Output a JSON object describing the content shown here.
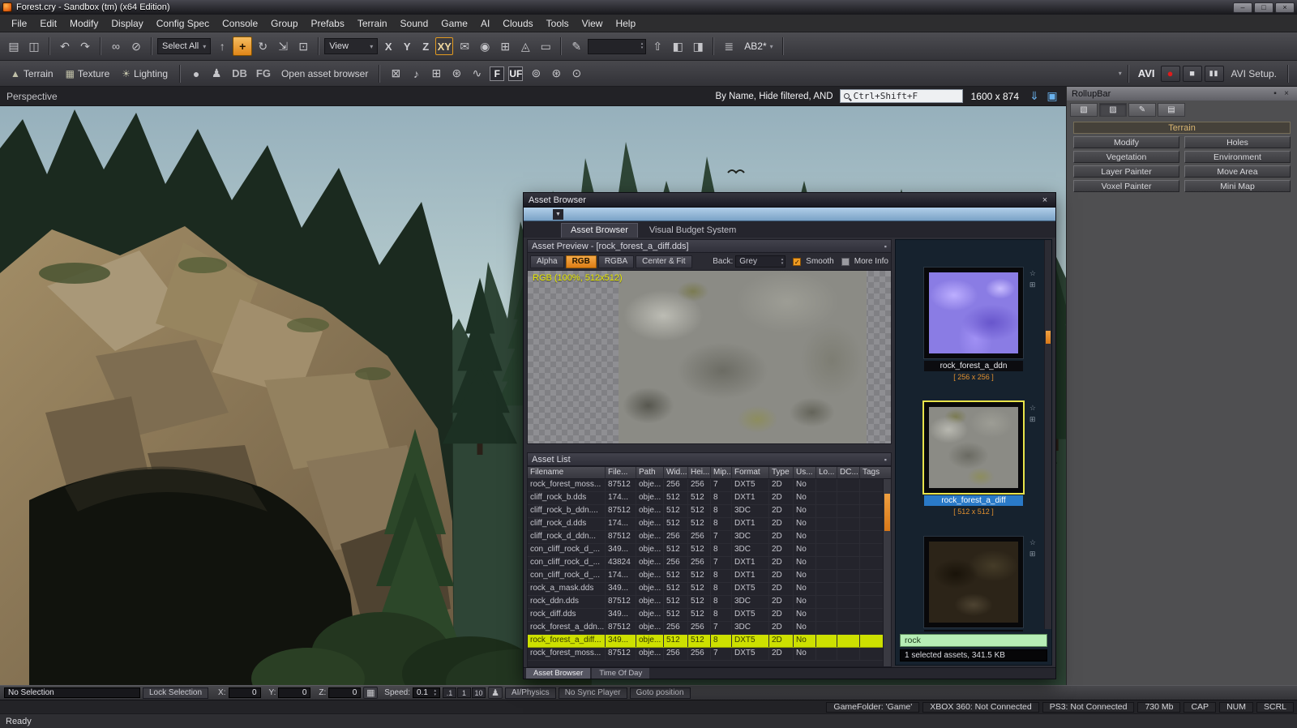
{
  "ui": {
    "dropdown_arrow": "▾",
    "spinner_up": "▴",
    "spinner_down": "▾",
    "pin_glyph": "▪",
    "star_glyph": "☆",
    "corner_glyph": "⊞"
  },
  "titlebar": {
    "title": "Forest.cry - Sandbox (tm) (x64 Edition)",
    "minimize": "–",
    "maximize": "□",
    "close": "×"
  },
  "menu": {
    "items": [
      {
        "label": "File",
        "name": "menu-file"
      },
      {
        "label": "Edit",
        "name": "menu-edit"
      },
      {
        "label": "Modify",
        "name": "menu-modify"
      },
      {
        "label": "Display",
        "name": "menu-display"
      },
      {
        "label": "Config Spec",
        "name": "menu-config-spec"
      },
      {
        "label": "Console",
        "name": "menu-console"
      },
      {
        "label": "Group",
        "name": "menu-group"
      },
      {
        "label": "Prefabs",
        "name": "menu-prefabs"
      },
      {
        "label": "Terrain",
        "name": "menu-terrain"
      },
      {
        "label": "Sound",
        "name": "menu-sound"
      },
      {
        "label": "Game",
        "name": "menu-game"
      },
      {
        "label": "AI",
        "name": "menu-ai"
      },
      {
        "label": "Clouds",
        "name": "menu-clouds"
      },
      {
        "label": "Tools",
        "name": "menu-tools"
      },
      {
        "label": "View",
        "name": "menu-view"
      },
      {
        "label": "Help",
        "name": "menu-help"
      }
    ]
  },
  "toolbar_main": {
    "file_icons": [
      {
        "glyph": "▤",
        "name": "open-file-icon"
      },
      {
        "glyph": "◫",
        "name": "save-icon"
      }
    ],
    "history_icons": [
      {
        "glyph": "↶",
        "name": "undo-icon"
      },
      {
        "glyph": "↷",
        "name": "redo-icon"
      }
    ],
    "link_icons": [
      {
        "glyph": "∞",
        "name": "link-icon"
      },
      {
        "glyph": "⊘",
        "name": "unlink-icon"
      }
    ],
    "select_all_value": "Select All",
    "transform_icons": [
      {
        "glyph": "↑",
        "name": "follow-terrain-icon"
      },
      {
        "glyph": "+",
        "name": "move-tool-icon",
        "active": true
      },
      {
        "glyph": "↻",
        "name": "rotate-tool-icon"
      },
      {
        "glyph": "⇲",
        "name": "scale-tool-icon"
      },
      {
        "glyph": "⊡",
        "name": "snap-icon"
      }
    ],
    "view_value": "View",
    "axis_buttons": [
      {
        "label": "X",
        "name": "axis-x-button"
      },
      {
        "label": "Y",
        "name": "axis-y-button"
      },
      {
        "label": "Z",
        "name": "axis-z-button"
      },
      {
        "label": "XY",
        "name": "axis-xy-button",
        "active": true
      }
    ],
    "misc_icons": [
      {
        "glyph": "✉",
        "name": "mail-icon"
      },
      {
        "glyph": "◉",
        "name": "camera-icon"
      },
      {
        "glyph": "⊞",
        "name": "grid-icon"
      },
      {
        "glyph": "◬",
        "name": "angle-snap-icon"
      },
      {
        "glyph": "▭",
        "name": "ruler-icon"
      }
    ],
    "script_icons": [
      {
        "glyph": "✎",
        "name": "script-icon"
      }
    ],
    "combo_value": "",
    "post_combo_icons": [
      {
        "glyph": "⇧",
        "name": "export-icon"
      },
      {
        "glyph": "◧",
        "name": "clone-icon"
      },
      {
        "glyph": "◨",
        "name": "align-icon"
      }
    ],
    "layer_icons": [
      {
        "glyph": "≣",
        "name": "layers-icon"
      }
    ],
    "ab2_label": "AB2*"
  },
  "toolbar_edit": {
    "labeled_buttons": [
      {
        "label": "Terrain",
        "glyph": "▲",
        "name": "terrain-button",
        "icon_name": "terrain-icon"
      },
      {
        "label": "Texture",
        "glyph": "▦",
        "name": "texture-button",
        "icon_name": "texture-icon"
      },
      {
        "label": "Lighting",
        "glyph": "☀",
        "name": "lighting-button",
        "icon_name": "lighting-icon"
      }
    ],
    "object_icons": [
      {
        "glyph": "●",
        "name": "material-sphere-icon"
      },
      {
        "glyph": "♟",
        "name": "character-icon"
      }
    ],
    "db_label": "DB",
    "fg_label": "FG",
    "open_asset_browser_label": "Open asset browser",
    "mid_icons": [
      {
        "glyph": "⊠",
        "name": "selection-mask-icon"
      },
      {
        "glyph": "♪",
        "name": "sound-icon"
      },
      {
        "glyph": "⊞",
        "name": "grid-snap-icon"
      },
      {
        "glyph": "⊛",
        "name": "particle-icon"
      },
      {
        "glyph": "∿",
        "name": "curve-editor-icon"
      }
    ],
    "f_label": "F",
    "uf_label": "UF",
    "editor_icons": [
      {
        "glyph": "⊚",
        "name": "track-view-icon"
      },
      {
        "glyph": "⊛",
        "name": "facial-editor-icon"
      },
      {
        "glyph": "⊙",
        "name": "flow-graph-icon"
      }
    ],
    "avi_label": "AVI",
    "record_glyph": "●",
    "stop_glyph": "■",
    "pause_glyph": "▮▮",
    "avi_setup_label": "AVI Setup."
  },
  "viewport": {
    "label": "Perspective",
    "filter_text": "By Name, Hide filtered, AND",
    "search_value": "Ctrl+Shift+F",
    "resolution": "1600 x 874",
    "header_icons": [
      {
        "glyph": "⇓",
        "name": "save-view-icon"
      },
      {
        "glyph": "▣",
        "name": "fullscreen-icon"
      }
    ]
  },
  "rollupbar": {
    "title": "RollupBar",
    "pin_glyph": "▪",
    "close_glyph": "×",
    "tabs": [
      {
        "glyph": "▧",
        "name": "rollup-tab-objects"
      },
      {
        "glyph": "▨",
        "name": "rollup-tab-terrain",
        "active": true
      },
      {
        "glyph": "✎",
        "name": "rollup-tab-modelling"
      },
      {
        "glyph": "▤",
        "name": "rollup-tab-display"
      }
    ],
    "section_title": "Terrain",
    "buttons": [
      {
        "label": "Modify",
        "name": "rollup-modify-button"
      },
      {
        "label": "Holes",
        "name": "rollup-holes-button"
      },
      {
        "label": "Vegetation",
        "name": "rollup-vegetation-button"
      },
      {
        "label": "Environment",
        "name": "rollup-environment-button"
      },
      {
        "label": "Layer Painter",
        "name": "rollup-layer-painter-button"
      },
      {
        "label": "Move Area",
        "name": "rollup-move-area-button"
      },
      {
        "label": "Voxel Painter",
        "name": "rollup-voxel-painter-button"
      },
      {
        "label": "Mini Map",
        "name": "rollup-mini-map-button"
      }
    ]
  },
  "asset_browser": {
    "title": "Asset Browser",
    "close_glyph": "×",
    "caret_glyph": "▼",
    "tabs": [
      {
        "label": "Asset Browser",
        "name": "ab-tab-asset-browser",
        "active": true
      },
      {
        "label": "Visual Budget System",
        "name": "ab-tab-visual-budget-system"
      }
    ],
    "preview_header": "Asset Preview - [rock_forest_a_diff.dds]",
    "channels": [
      {
        "label": "Alpha",
        "name": "alpha-channel-button"
      },
      {
        "label": "RGB",
        "name": "rgb-channel-button",
        "active": true
      },
      {
        "label": "RGBA",
        "name": "rgba-channel-button"
      },
      {
        "label": "Center & Fit",
        "name": "center-fit-button"
      }
    ],
    "back_label": "Back:",
    "back_value": "Grey",
    "smooth_check": "✓",
    "smooth_label": "Smooth",
    "more_info_label": "More Info",
    "preview_info": "RGB (100%, 512x512)",
    "list_header": "Asset List",
    "columns": [
      "Filename",
      "File...",
      "Path",
      "Wid...",
      "Hei...",
      "Mip...",
      "Format",
      "Type",
      "Us...",
      "Lo...",
      "DC...",
      "Tags"
    ],
    "rows": [
      {
        "filename": "rock_forest_moss...",
        "file": "87512",
        "path": "obje...",
        "wid": "256",
        "hei": "256",
        "mip": "7",
        "format": "DXT5",
        "type": "2D",
        "us": "No"
      },
      {
        "filename": "cliff_rock_b.dds",
        "file": "174...",
        "path": "obje...",
        "wid": "512",
        "hei": "512",
        "mip": "8",
        "format": "DXT1",
        "type": "2D",
        "us": "No"
      },
      {
        "filename": "cliff_rock_b_ddn....",
        "file": "87512",
        "path": "obje...",
        "wid": "512",
        "hei": "512",
        "mip": "8",
        "format": "3DC",
        "type": "2D",
        "us": "No"
      },
      {
        "filename": "cliff_rock_d.dds",
        "file": "174...",
        "path": "obje...",
        "wid": "512",
        "hei": "512",
        "mip": "8",
        "format": "DXT1",
        "type": "2D",
        "us": "No"
      },
      {
        "filename": "cliff_rock_d_ddn...",
        "file": "87512",
        "path": "obje...",
        "wid": "256",
        "hei": "256",
        "mip": "7",
        "format": "3DC",
        "type": "2D",
        "us": "No"
      },
      {
        "filename": "con_cliff_rock_d_...",
        "file": "349...",
        "path": "obje...",
        "wid": "512",
        "hei": "512",
        "mip": "8",
        "format": "3DC",
        "type": "2D",
        "us": "No"
      },
      {
        "filename": "con_cliff_rock_d_...",
        "file": "43824",
        "path": "obje...",
        "wid": "256",
        "hei": "256",
        "mip": "7",
        "format": "DXT1",
        "type": "2D",
        "us": "No"
      },
      {
        "filename": "con_cliff_rock_d_...",
        "file": "174...",
        "path": "obje...",
        "wid": "512",
        "hei": "512",
        "mip": "8",
        "format": "DXT1",
        "type": "2D",
        "us": "No"
      },
      {
        "filename": "rock_a_mask.dds",
        "file": "349...",
        "path": "obje...",
        "wid": "512",
        "hei": "512",
        "mip": "8",
        "format": "DXT5",
        "type": "2D",
        "us": "No"
      },
      {
        "filename": "rock_ddn.dds",
        "file": "87512",
        "path": "obje...",
        "wid": "512",
        "hei": "512",
        "mip": "8",
        "format": "3DC",
        "type": "2D",
        "us": "No"
      },
      {
        "filename": "rock_diff.dds",
        "file": "349...",
        "path": "obje...",
        "wid": "512",
        "hei": "512",
        "mip": "8",
        "format": "DXT5",
        "type": "2D",
        "us": "No"
      },
      {
        "filename": "rock_forest_a_ddn...",
        "file": "87512",
        "path": "obje...",
        "wid": "256",
        "hei": "256",
        "mip": "7",
        "format": "3DC",
        "type": "2D",
        "us": "No"
      },
      {
        "filename": "rock_forest_a_diff...",
        "file": "349...",
        "path": "obje...",
        "wid": "512",
        "hei": "512",
        "mip": "8",
        "format": "DXT5",
        "type": "2D",
        "us": "No",
        "selected": true
      },
      {
        "filename": "rock_forest_moss...",
        "file": "87512",
        "path": "obje...",
        "wid": "256",
        "hei": "256",
        "mip": "7",
        "format": "DXT5",
        "type": "2D",
        "us": "No"
      }
    ],
    "thumbnails": [
      {
        "label": "rock_forest_a_ddn",
        "size": "[ 256 x 256 ]",
        "kind": "ddn",
        "name": "thumbnail-rock-forest-a-ddn"
      },
      {
        "label": "rock_forest_a_diff",
        "size": "[ 512 x 512 ]",
        "kind": "diff",
        "selected": true,
        "name": "thumbnail-rock-forest-a-diff"
      },
      {
        "label": "",
        "size": "",
        "kind": "dark",
        "name": "thumbnail-partial"
      }
    ],
    "search_value": "rock",
    "status": "1 selected assets, 341.5 KB",
    "bottom_tabs": [
      {
        "label": "Asset Browser",
        "name": "dock-tab-asset-browser",
        "active": true
      },
      {
        "label": "Time Of Day",
        "name": "dock-tab-time-of-day"
      }
    ]
  },
  "bottom_toolbar": {
    "selection_value": "No Selection",
    "lock_selection_label": "Lock Selection",
    "coords": [
      {
        "label": "X:",
        "value": "0",
        "name": "x-coordinate-field"
      },
      {
        "label": "Y:",
        "value": "0",
        "name": "y-coordinate-field"
      },
      {
        "label": "Z:",
        "value": "0",
        "name": "z-coordinate-field"
      }
    ],
    "terrain_collision_glyph": "▦",
    "speed_label": "Speed:",
    "speed_value": "0.1",
    "speed_presets": [
      {
        "label": ".1",
        "name": "speed-preset-point1-button"
      },
      {
        "label": "1",
        "name": "speed-preset-1-button"
      },
      {
        "label": "10",
        "name": "speed-preset-10-button"
      }
    ],
    "character_glyph": "♟",
    "ai_physics_label": "AI/Physics",
    "no_sync_label": "No Sync Player",
    "goto_label": "Goto position"
  },
  "statusbar": {
    "info_items": [
      {
        "label": "GameFolder: 'Game'",
        "name": "status-gamefolder"
      },
      {
        "label": "XBOX 360: Not Connected",
        "name": "status-xbox360"
      },
      {
        "label": "PS3: Not Connected",
        "name": "status-ps3"
      },
      {
        "label": "730 Mb",
        "name": "status-memory"
      },
      {
        "label": "CAP",
        "name": "status-cap"
      },
      {
        "label": "NUM",
        "name": "status-num"
      },
      {
        "label": "SCRL",
        "name": "status-scrl"
      }
    ],
    "ready": "Ready"
  }
}
